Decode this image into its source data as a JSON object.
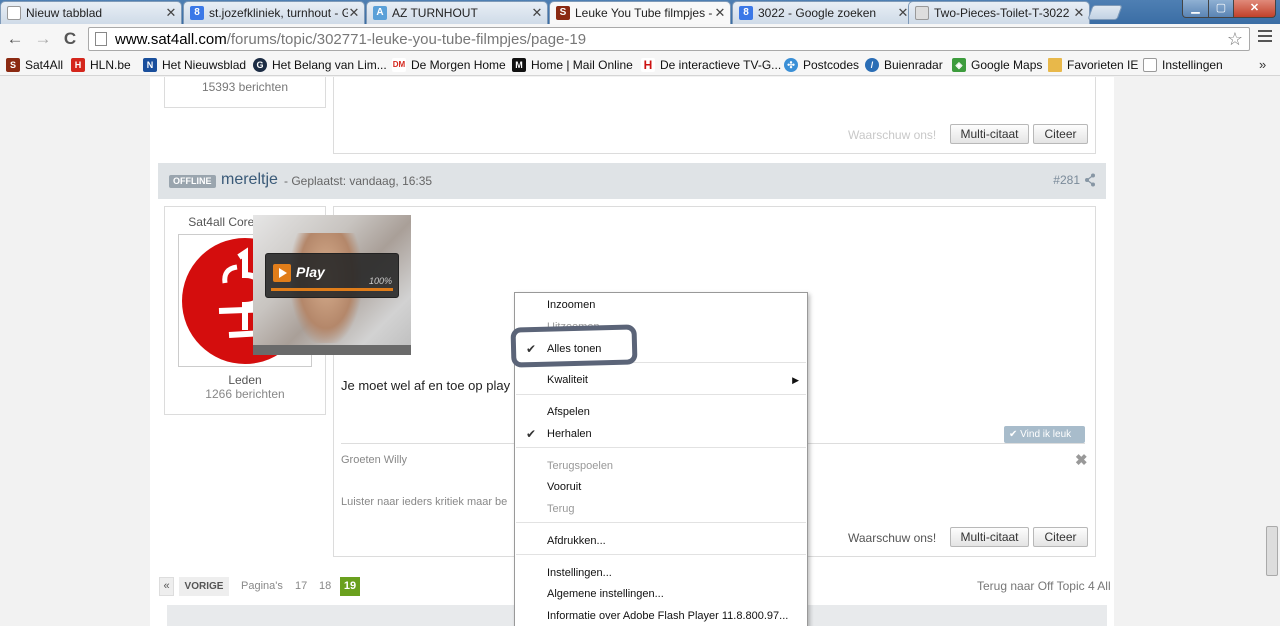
{
  "tabs": [
    {
      "title": "Nieuw tabblad",
      "favicon": "blank-page-icon",
      "active": false
    },
    {
      "title": "st.jozefkliniek, turnhout - G",
      "favicon": "google-icon",
      "active": false
    },
    {
      "title": "AZ TURNHOUT",
      "favicon": "az-turnhout-icon",
      "active": false
    },
    {
      "title": "Leuke You Tube filmpjes -",
      "favicon": "sat4all-icon",
      "active": true
    },
    {
      "title": "3022 - Google zoeken",
      "favicon": "google-icon",
      "active": false
    },
    {
      "title": "Two-Pieces-Toilet-T-3022",
      "favicon": "page-thumb-icon",
      "active": false
    }
  ],
  "toolbar": {
    "back": "←",
    "forward": "→",
    "reload": "C",
    "url_host": "www.sat4all.com",
    "url_path": "/forums/topic/302771-leuke-you-tube-filmpjes/page-19"
  },
  "bookmarks": [
    {
      "label": "Sat4All",
      "icon": "sat4all-icon",
      "color": "#8b2a12"
    },
    {
      "label": "HLN.be",
      "icon": "hln-icon",
      "color": "#d4261c"
    },
    {
      "label": "Het Nieuwsblad",
      "icon": "nieuwsblad-icon",
      "color": "#1a4f9c"
    },
    {
      "label": "Het Belang van Lim...",
      "icon": "hbvl-icon",
      "color": "#1c2c44"
    },
    {
      "label": "De Morgen Home",
      "icon": "demorgen-icon",
      "color": "#d4261c"
    },
    {
      "label": "Home | Mail Online",
      "icon": "mailonline-icon",
      "color": "#111111"
    },
    {
      "label": "De interactieve TV-G...",
      "icon": "tvgids-icon",
      "color": "#cc1111"
    },
    {
      "label": "Postcodes",
      "icon": "postcodes-icon",
      "color": "#3a8fd6"
    },
    {
      "label": "Buienradar",
      "icon": "buienradar-icon",
      "color": "#2a6db5"
    },
    {
      "label": "Google Maps",
      "icon": "google-maps-icon",
      "color": "#3d9c3d"
    },
    {
      "label": "Favorieten IE",
      "icon": "folder-icon",
      "color": "#e8b84a"
    },
    {
      "label": "Instellingen",
      "icon": "blank-page-icon",
      "color": "#ffffff"
    }
  ],
  "bookmarks_more": "»",
  "prev_post": {
    "count": "15393 berichten",
    "warn": "Waarschuw ons!",
    "multiquote": "Multi-citaat",
    "quote": "Citeer"
  },
  "post": {
    "status": "OFFLINE",
    "author": "mereltje",
    "posted": "- Geplaatst: vandaag, 16:35",
    "number": "#281",
    "rank": "Sat4all Core Member",
    "group": "Leden",
    "count": "1266 berichten",
    "text": "Je moet wel af en toe op play",
    "like": "Vind ik leuk",
    "signature1": "Groeten Willy",
    "signature2": "Luister naar ieders kritiek maar be",
    "warn": "Waarschuw ons!",
    "multiquote": "Multi-citaat",
    "quote": "Citeer"
  },
  "video": {
    "play_label": "Play",
    "progress_text": "100%",
    "progress": 1.0
  },
  "context_menu": [
    {
      "label": "Inzoomen",
      "checked": false,
      "disabled": false
    },
    {
      "label": "Uitzoomen",
      "checked": false,
      "disabled": true
    },
    {
      "label": "Alles tonen",
      "checked": true,
      "disabled": false
    },
    {
      "label": "Kwaliteit",
      "checked": false,
      "disabled": false,
      "submenu": true
    },
    {
      "label": "Afspelen",
      "checked": false,
      "disabled": false
    },
    {
      "label": "Herhalen",
      "checked": true,
      "disabled": false
    },
    {
      "label": "Terugspoelen",
      "checked": false,
      "disabled": true
    },
    {
      "label": "Vooruit",
      "checked": false,
      "disabled": false
    },
    {
      "label": "Terug",
      "checked": false,
      "disabled": true
    },
    {
      "label": "Afdrukken...",
      "checked": false,
      "disabled": false
    },
    {
      "label": "Instellingen...",
      "checked": false,
      "disabled": false
    },
    {
      "label": "Algemene instellingen...",
      "checked": false,
      "disabled": false
    },
    {
      "label": "Informatie over Adobe Flash Player 11.8.800.97...",
      "checked": false,
      "disabled": false
    }
  ],
  "pagination": {
    "prev_arrow": "«",
    "prev": "VORIGE",
    "pages_label": "Pagina's",
    "pages": [
      "17",
      "18",
      "19"
    ],
    "current": "19",
    "back_link": "Terug naar Off Topic 4 All"
  },
  "colors": {
    "accent_current_page": "#6aa01e",
    "play_orange": "#e07d1a",
    "logo_red": "#d40d0d"
  }
}
